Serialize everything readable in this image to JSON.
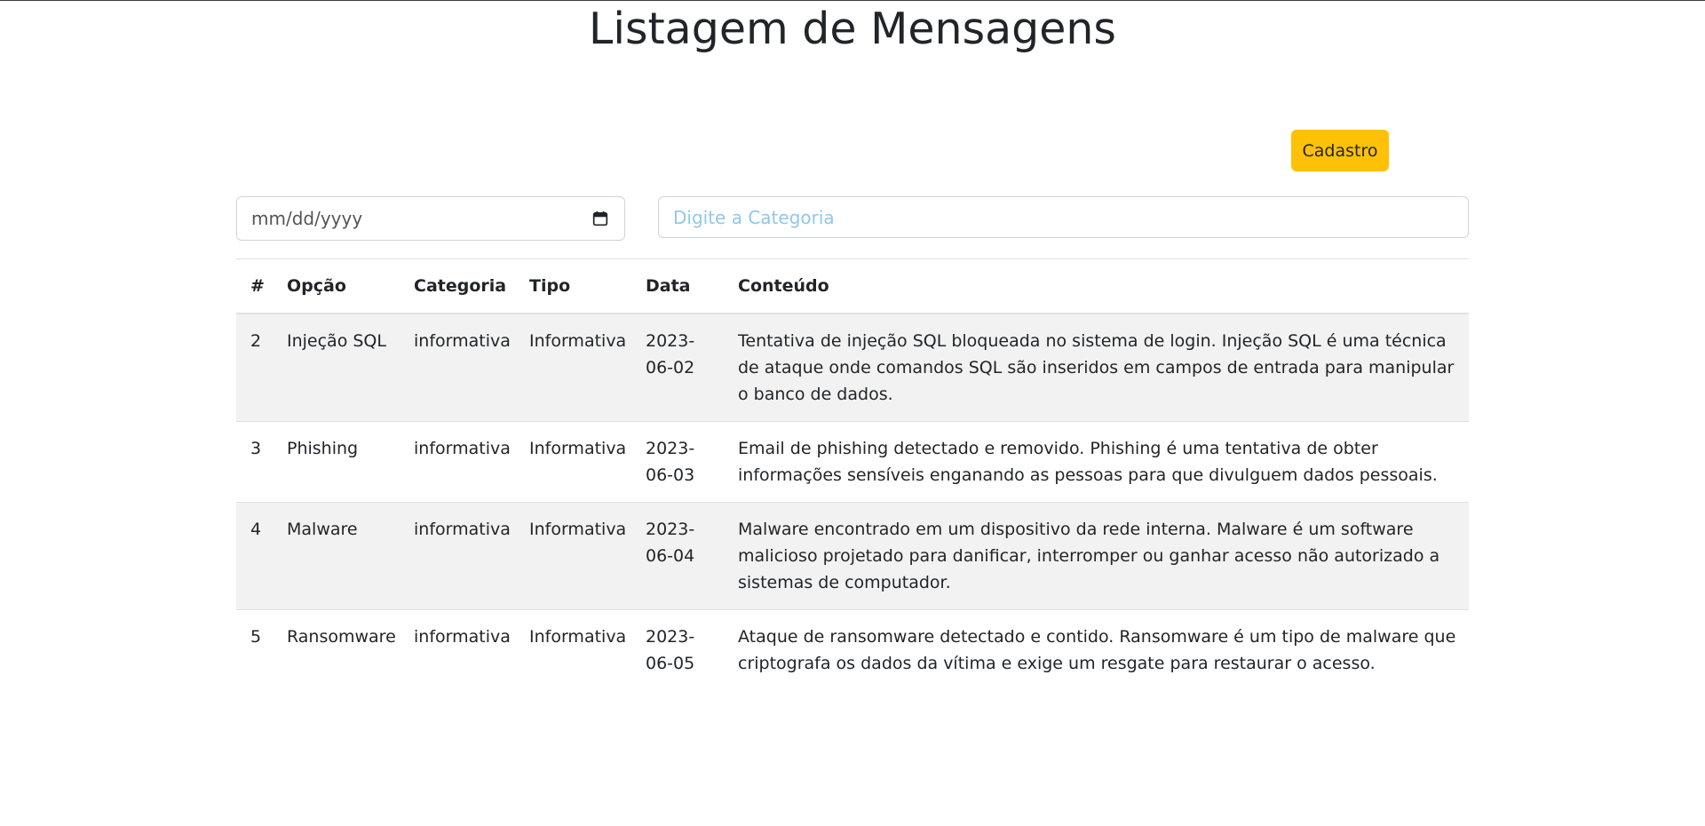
{
  "page": {
    "title": "Listagem de Mensagens"
  },
  "toolbar": {
    "cadastro_label": "Cadastro"
  },
  "filters": {
    "date_placeholder": "mm/dd/yyyy",
    "category_placeholder": "Digite a Categoria"
  },
  "table": {
    "headers": {
      "id": "#",
      "opcao": "Opção",
      "categoria": "Categoria",
      "tipo": "Tipo",
      "data": "Data",
      "conteudo": "Conteúdo"
    },
    "rows": [
      {
        "id": "2",
        "opcao": "Injeção SQL",
        "categoria": "informativa",
        "tipo": "Informativa",
        "data": "2023-06-02",
        "conteudo": "Tentativa de injeção SQL bloqueada no sistema de login. Injeção SQL é uma técnica de ataque onde comandos SQL são inseridos em campos de entrada para manipular o banco de dados."
      },
      {
        "id": "3",
        "opcao": "Phishing",
        "categoria": "informativa",
        "tipo": "Informativa",
        "data": "2023-06-03",
        "conteudo": "Email de phishing detectado e removido. Phishing é uma tentativa de obter informações sensíveis enganando as pessoas para que divulguem dados pessoais."
      },
      {
        "id": "4",
        "opcao": "Malware",
        "categoria": "informativa",
        "tipo": "Informativa",
        "data": "2023-06-04",
        "conteudo": "Malware encontrado em um dispositivo da rede interna. Malware é um software malicioso projetado para danificar, interromper ou ganhar acesso não autorizado a sistemas de computador."
      },
      {
        "id": "5",
        "opcao": "Ransomware",
        "categoria": "informativa",
        "tipo": "Informativa",
        "data": "2023-06-05",
        "conteudo": "Ataque de ransomware detectado e contido. Ransomware é um tipo de malware que criptografa os dados da vítima e exige um resgate para restaurar o acesso."
      }
    ]
  },
  "colors": {
    "accent_button": "#ffc107",
    "placeholder": "#8ec9ea",
    "stripe": "#f2f2f2"
  }
}
